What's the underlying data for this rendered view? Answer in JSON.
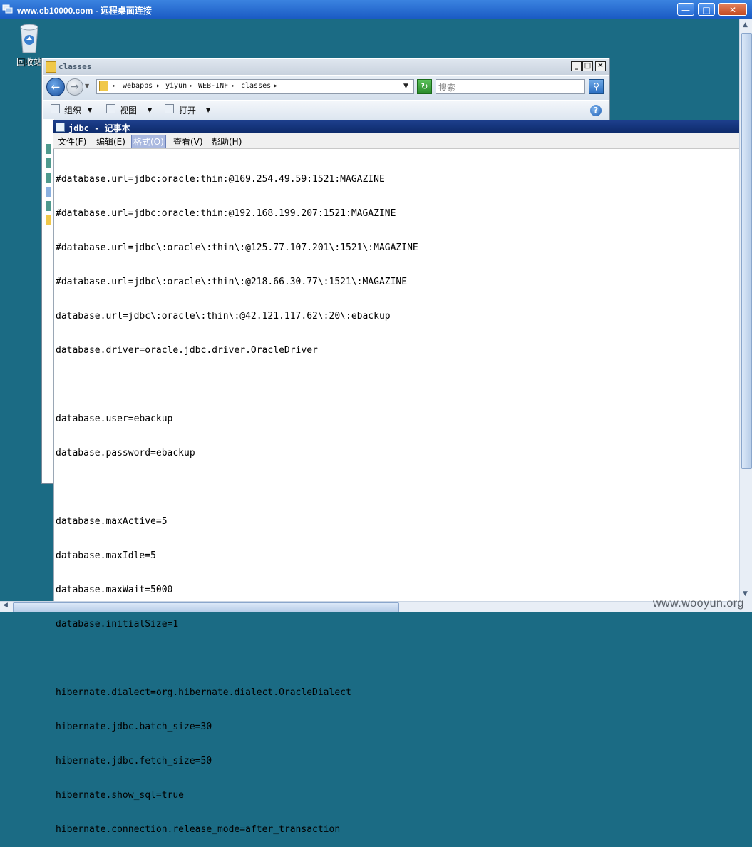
{
  "rdp": {
    "title": "www.cb10000.com - 远程桌面连接",
    "minimize_glyph": "—",
    "maximize_glyph": "□",
    "close_glyph": "✕"
  },
  "desktop": {
    "recycle_bin_label": "回收站",
    "watermark": "www.wooyun.org"
  },
  "explorer": {
    "title": "classes",
    "breadcrumb": [
      "webapps",
      "yiyun",
      "WEB-INF",
      "classes"
    ],
    "search_placeholder": "搜索",
    "toolbar": {
      "organize": "组织",
      "views": "视图",
      "open": "打开"
    },
    "help_glyph": "?"
  },
  "notepad": {
    "title": "jdbc - 记事本",
    "menu": [
      "文件(F)",
      "编辑(E)",
      "格式(O)",
      "查看(V)",
      "帮助(H)"
    ],
    "active_menu_index": 2,
    "lines": [
      "#database.url=jdbc:oracle:thin:@169.254.49.59:1521:MAGAZINE",
      "#database.url=jdbc:oracle:thin:@192.168.199.207:1521:MAGAZINE",
      "#database.url=jdbc\\:oracle\\:thin\\:@125.77.107.201\\:1521\\:MAGAZINE",
      "#database.url=jdbc\\:oracle\\:thin\\:@218.66.30.77\\:1521\\:MAGAZINE",
      "database.url=jdbc\\:oracle\\:thin\\:@42.121.117.62\\:20\\:ebackup",
      "database.driver=oracle.jdbc.driver.OracleDriver",
      "",
      "database.user=ebackup",
      "database.password=ebackup",
      "",
      "database.maxActive=5",
      "database.maxIdle=5",
      "database.maxWait=5000",
      "database.initialSize=1",
      "",
      "hibernate.dialect=org.hibernate.dialect.OracleDialect",
      "hibernate.jdbc.batch_size=30",
      "hibernate.jdbc.fetch_size=50",
      "hibernate.show_sql=true",
      "hibernate.connection.release_mode=after_transaction"
    ]
  },
  "colors": {
    "desktop": "#1b6b84",
    "rdp_titlebar": "#1a5bc4",
    "notepad_titlebar": "#0d2a6a"
  }
}
